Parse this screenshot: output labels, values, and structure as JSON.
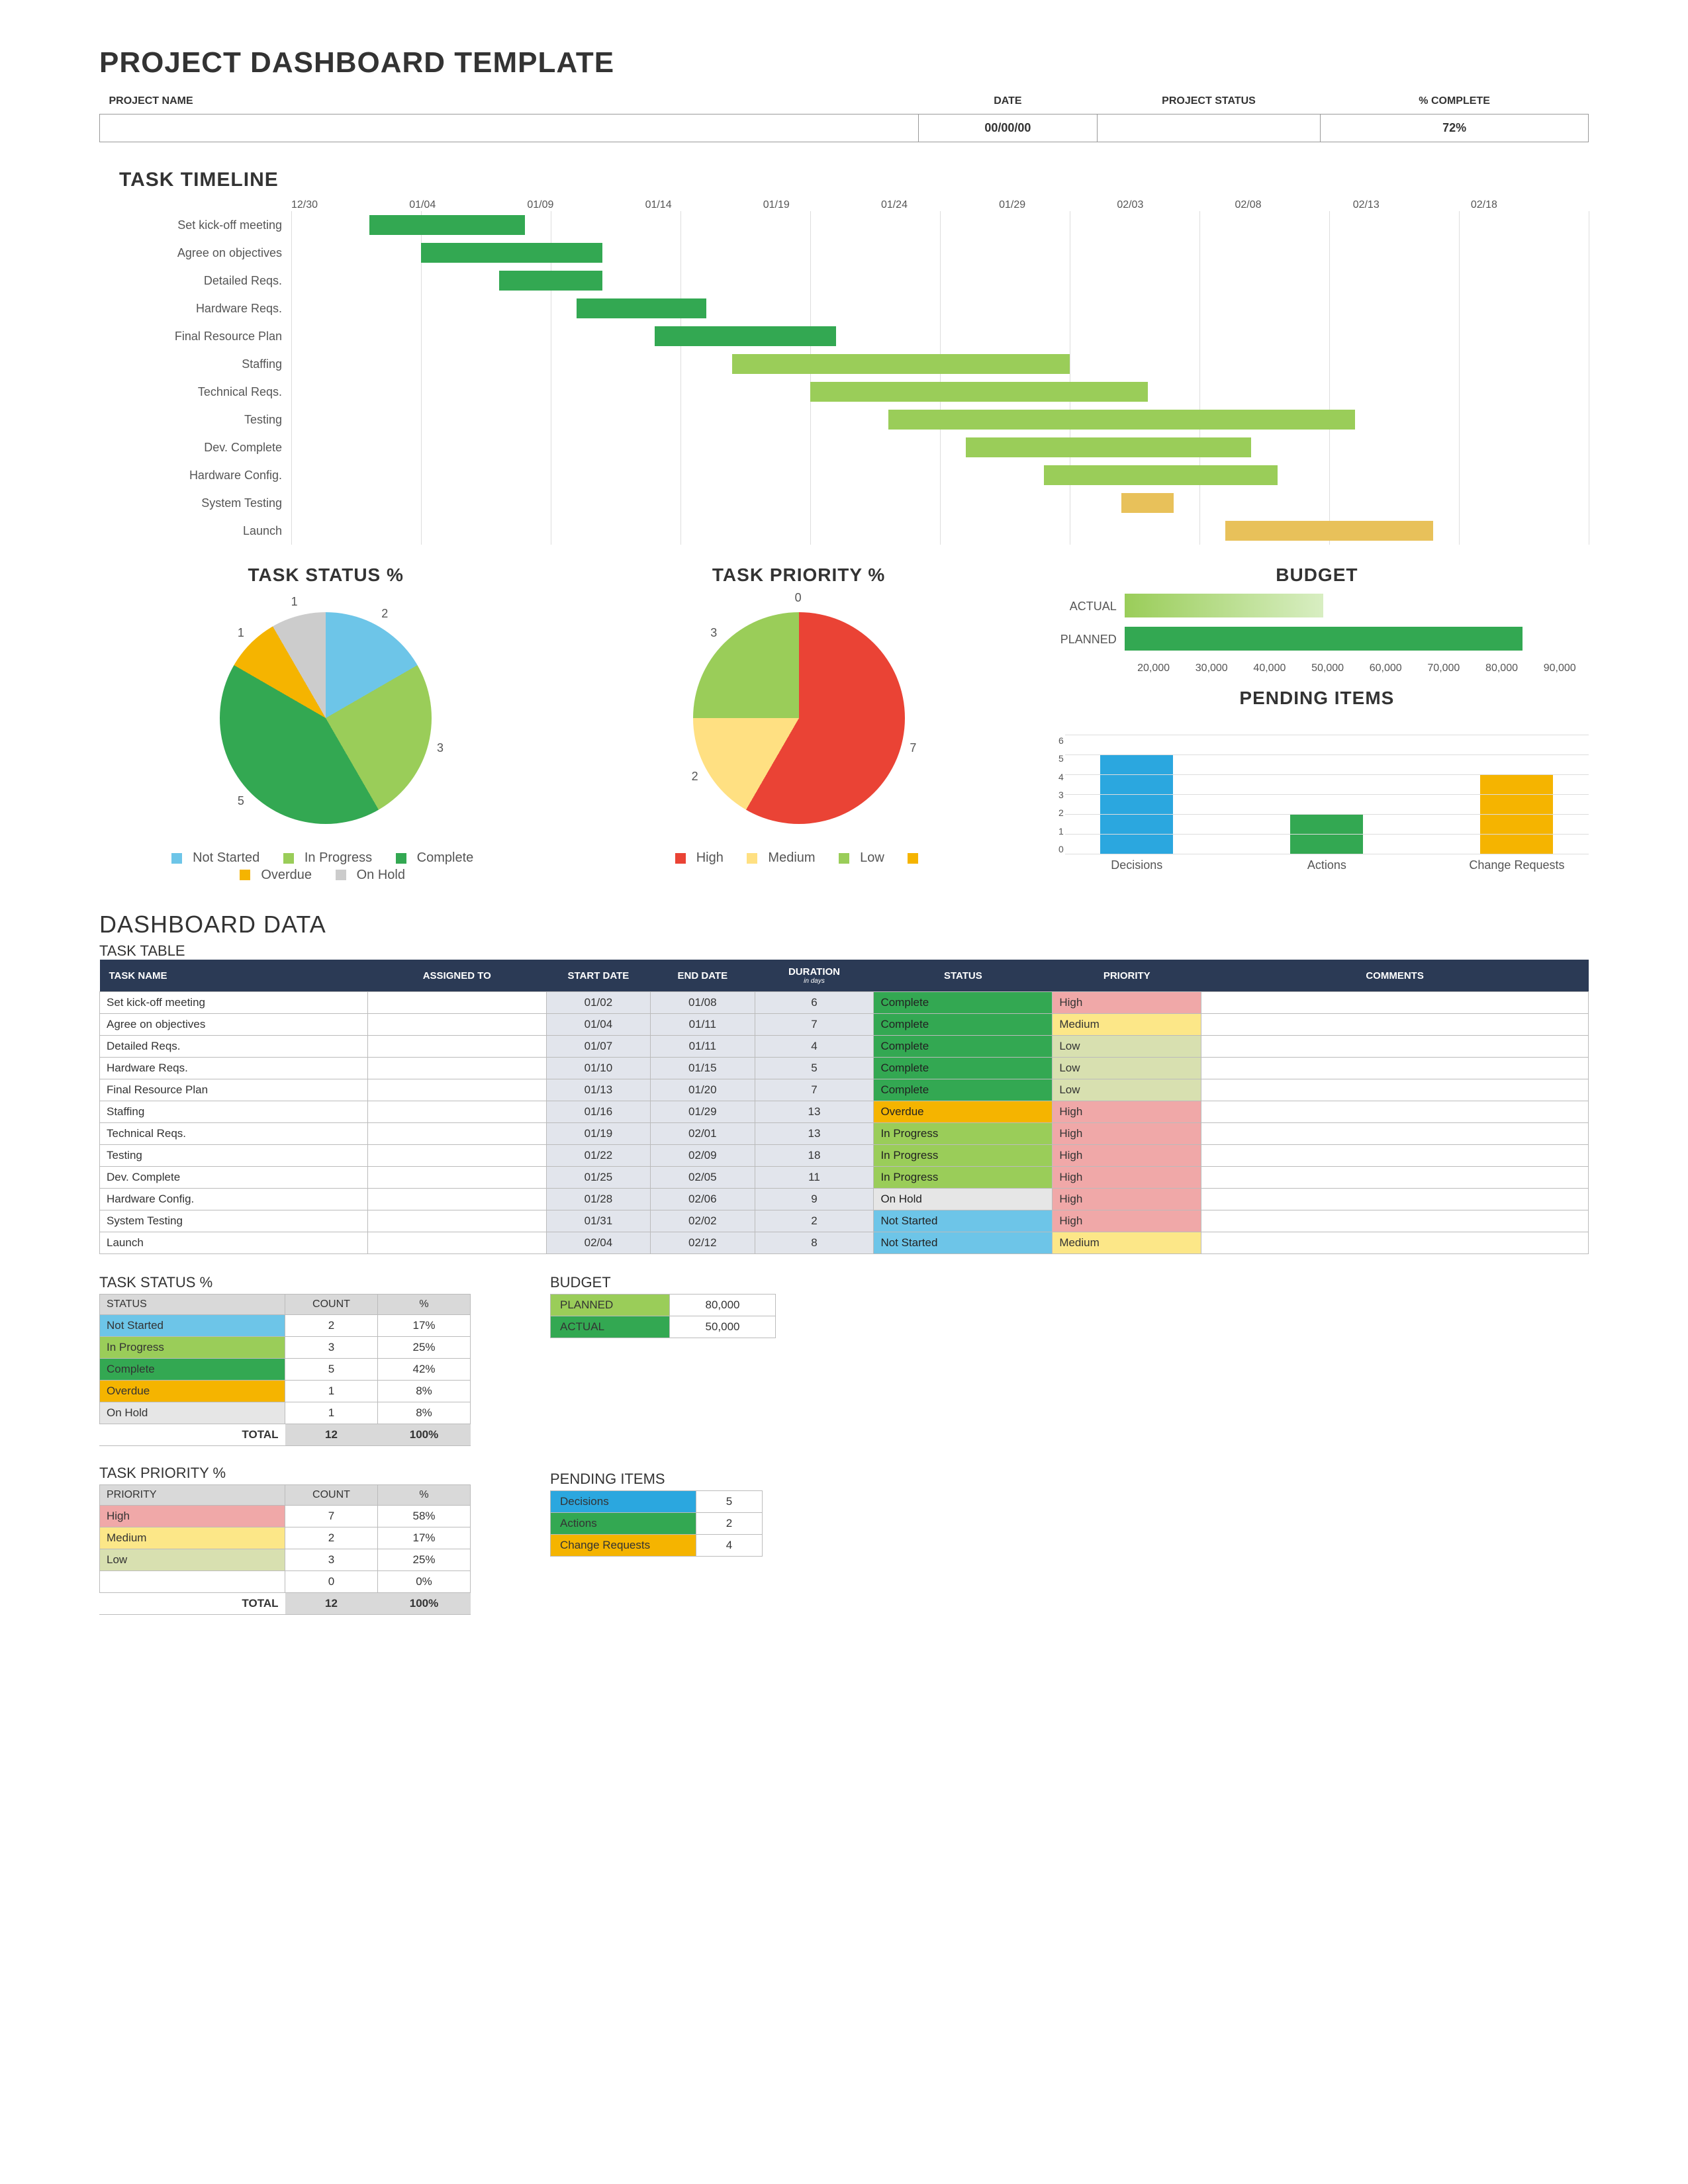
{
  "page": {
    "title": "PROJECT DASHBOARD TEMPLATE"
  },
  "header": {
    "project_name_label": "PROJECT NAME",
    "date_label": "DATE",
    "status_label": "PROJECT STATUS",
    "complete_label": "% COMPLETE",
    "project_name_value": "",
    "date_value": "00/00/00",
    "status_value": "",
    "complete_value": "72%"
  },
  "timeline": {
    "title": "TASK TIMELINE",
    "dates": [
      "12/30",
      "01/04",
      "01/09",
      "01/14",
      "01/19",
      "01/24",
      "01/29",
      "02/03",
      "02/08",
      "02/13",
      "02/18"
    ],
    "tasks": [
      {
        "name": "Set kick-off meeting"
      },
      {
        "name": "Agree on objectives"
      },
      {
        "name": "Detailed Reqs."
      },
      {
        "name": "Hardware Reqs."
      },
      {
        "name": "Final Resource Plan"
      },
      {
        "name": "Staffing"
      },
      {
        "name": "Technical Reqs."
      },
      {
        "name": "Testing"
      },
      {
        "name": "Dev. Complete"
      },
      {
        "name": "Hardware Config."
      },
      {
        "name": "System Testing"
      },
      {
        "name": "Launch"
      }
    ]
  },
  "task_status_chart": {
    "title": "TASK STATUS %"
  },
  "task_priority_chart": {
    "title": "TASK PRIORITY %"
  },
  "budget_chart": {
    "title": "BUDGET",
    "actual_label": "ACTUAL",
    "planned_label": "PLANNED"
  },
  "pending_chart": {
    "title": "PENDING ITEMS"
  },
  "legend_status": {
    "not_started": "Not Started",
    "in_progress": "In Progress",
    "complete": "Complete",
    "overdue": "Overdue",
    "on_hold": "On Hold"
  },
  "legend_priority": {
    "high": "High",
    "medium": "Medium",
    "low": "Low"
  },
  "dashboard": {
    "title": "DASHBOARD DATA",
    "task_table_title": "TASK TABLE",
    "task_status_title": "TASK STATUS %",
    "task_priority_title": "TASK PRIORITY %",
    "budget_title": "BUDGET",
    "pending_title": "PENDING ITEMS"
  },
  "task_table": {
    "headers": {
      "task_name": "TASK NAME",
      "assigned": "ASSIGNED TO",
      "start": "START DATE",
      "end": "END DATE",
      "duration": "DURATION",
      "duration_sub": "in days",
      "status": "STATUS",
      "priority": "PRIORITY",
      "comments": "COMMENTS"
    },
    "rows": [
      {
        "name": "Set kick-off meeting",
        "assigned": "",
        "start": "01/02",
        "end": "01/08",
        "duration": "6",
        "status": "Complete",
        "priority": "High",
        "comments": ""
      },
      {
        "name": "Agree on objectives",
        "assigned": "",
        "start": "01/04",
        "end": "01/11",
        "duration": "7",
        "status": "Complete",
        "priority": "Medium",
        "comments": ""
      },
      {
        "name": "Detailed Reqs.",
        "assigned": "",
        "start": "01/07",
        "end": "01/11",
        "duration": "4",
        "status": "Complete",
        "priority": "Low",
        "comments": ""
      },
      {
        "name": "Hardware Reqs.",
        "assigned": "",
        "start": "01/10",
        "end": "01/15",
        "duration": "5",
        "status": "Complete",
        "priority": "Low",
        "comments": ""
      },
      {
        "name": "Final Resource Plan",
        "assigned": "",
        "start": "01/13",
        "end": "01/20",
        "duration": "7",
        "status": "Complete",
        "priority": "Low",
        "comments": ""
      },
      {
        "name": "Staffing",
        "assigned": "",
        "start": "01/16",
        "end": "01/29",
        "duration": "13",
        "status": "Overdue",
        "priority": "High",
        "comments": ""
      },
      {
        "name": "Technical Reqs.",
        "assigned": "",
        "start": "01/19",
        "end": "02/01",
        "duration": "13",
        "status": "In Progress",
        "priority": "High",
        "comments": ""
      },
      {
        "name": "Testing",
        "assigned": "",
        "start": "01/22",
        "end": "02/09",
        "duration": "18",
        "status": "In Progress",
        "priority": "High",
        "comments": ""
      },
      {
        "name": "Dev. Complete",
        "assigned": "",
        "start": "01/25",
        "end": "02/05",
        "duration": "11",
        "status": "In Progress",
        "priority": "High",
        "comments": ""
      },
      {
        "name": "Hardware Config.",
        "assigned": "",
        "start": "01/28",
        "end": "02/06",
        "duration": "9",
        "status": "On Hold",
        "priority": "High",
        "comments": ""
      },
      {
        "name": "System Testing",
        "assigned": "",
        "start": "01/31",
        "end": "02/02",
        "duration": "2",
        "status": "Not Started",
        "priority": "High",
        "comments": ""
      },
      {
        "name": "Launch",
        "assigned": "",
        "start": "02/04",
        "end": "02/12",
        "duration": "8",
        "status": "Not Started",
        "priority": "Medium",
        "comments": ""
      }
    ]
  },
  "status_summary": {
    "headers": {
      "status": "STATUS",
      "count": "COUNT",
      "pct": "%"
    },
    "rows": [
      {
        "label": "Not Started",
        "count": "2",
        "pct": "17%"
      },
      {
        "label": "In Progress",
        "count": "3",
        "pct": "25%"
      },
      {
        "label": "Complete",
        "count": "5",
        "pct": "42%"
      },
      {
        "label": "Overdue",
        "count": "1",
        "pct": "8%"
      },
      {
        "label": "On Hold",
        "count": "1",
        "pct": "8%"
      }
    ],
    "total_label": "TOTAL",
    "total_count": "12",
    "total_pct": "100%"
  },
  "priority_summary": {
    "headers": {
      "priority": "PRIORITY",
      "count": "COUNT",
      "pct": "%"
    },
    "rows": [
      {
        "label": "High",
        "count": "7",
        "pct": "58%"
      },
      {
        "label": "Medium",
        "count": "2",
        "pct": "17%"
      },
      {
        "label": "Low",
        "count": "3",
        "pct": "25%"
      },
      {
        "label": "",
        "count": "0",
        "pct": "0%"
      }
    ],
    "total_label": "TOTAL",
    "total_count": "12",
    "total_pct": "100%"
  },
  "budget_summary": {
    "planned_label": "PLANNED",
    "planned_value": "80,000",
    "actual_label": "ACTUAL",
    "actual_value": "50,000"
  },
  "pending_summary": {
    "rows": [
      {
        "label": "Decisions",
        "value": "5"
      },
      {
        "label": "Actions",
        "value": "2"
      },
      {
        "label": "Change Requests",
        "value": "4"
      }
    ]
  },
  "chart_data": [
    {
      "type": "gantt",
      "title": "TASK TIMELINE",
      "x_ticks": [
        "12/30",
        "01/04",
        "01/09",
        "01/14",
        "01/19",
        "01/24",
        "01/29",
        "02/03",
        "02/08",
        "02/13",
        "02/18"
      ],
      "x_range_days": 50,
      "tasks": [
        {
          "name": "Set kick-off meeting",
          "start": "01/02",
          "end": "01/08",
          "status": "Complete",
          "color": "#33a852"
        },
        {
          "name": "Agree on objectives",
          "start": "01/04",
          "end": "01/11",
          "status": "Complete",
          "color": "#33a852"
        },
        {
          "name": "Detailed Reqs.",
          "start": "01/07",
          "end": "01/11",
          "status": "Complete",
          "color": "#33a852"
        },
        {
          "name": "Hardware Reqs.",
          "start": "01/10",
          "end": "01/15",
          "status": "Complete",
          "color": "#33a852"
        },
        {
          "name": "Final Resource Plan",
          "start": "01/13",
          "end": "01/20",
          "status": "Complete",
          "color": "#33a852"
        },
        {
          "name": "Staffing",
          "start": "01/16",
          "end": "01/29",
          "status": "Overdue",
          "color": "#9acd59"
        },
        {
          "name": "Technical Reqs.",
          "start": "01/19",
          "end": "02/01",
          "status": "In Progress",
          "color": "#9acd59"
        },
        {
          "name": "Testing",
          "start": "01/22",
          "end": "02/09",
          "status": "In Progress",
          "color": "#9acd59"
        },
        {
          "name": "Dev. Complete",
          "start": "01/25",
          "end": "02/05",
          "status": "In Progress",
          "color": "#9acd59"
        },
        {
          "name": "Hardware Config.",
          "start": "01/28",
          "end": "02/06",
          "status": "On Hold",
          "color": "#9acd59"
        },
        {
          "name": "System Testing",
          "start": "01/31",
          "end": "02/02",
          "status": "Not Started",
          "color": "#e8c15a"
        },
        {
          "name": "Launch",
          "start": "02/04",
          "end": "02/12",
          "status": "Not Started",
          "color": "#e8c15a"
        }
      ]
    },
    {
      "type": "pie",
      "title": "TASK STATUS %",
      "series": [
        {
          "name": "Not Started",
          "value": 2,
          "color": "#6dc5e8"
        },
        {
          "name": "In Progress",
          "value": 3,
          "color": "#9acd59"
        },
        {
          "name": "Complete",
          "value": 5,
          "color": "#33a852"
        },
        {
          "name": "Overdue",
          "value": 1,
          "color": "#f5b400"
        },
        {
          "name": "On Hold",
          "value": 1,
          "color": "#cccccc"
        }
      ],
      "total": 12
    },
    {
      "type": "pie",
      "title": "TASK PRIORITY %",
      "series": [
        {
          "name": "High",
          "value": 7,
          "color": "#ea4335"
        },
        {
          "name": "Medium",
          "value": 2,
          "color": "#ffe082"
        },
        {
          "name": "Low",
          "value": 3,
          "color": "#9acd59"
        },
        {
          "name": "",
          "value": 0,
          "color": "#f5b400"
        }
      ],
      "total": 12
    },
    {
      "type": "bar",
      "orientation": "horizontal",
      "title": "BUDGET",
      "categories": [
        "ACTUAL",
        "PLANNED"
      ],
      "values": [
        50000,
        80000
      ],
      "x_ticks": [
        20000,
        30000,
        40000,
        50000,
        60000,
        70000,
        80000,
        90000
      ],
      "xlim": [
        20000,
        90000
      ],
      "colors": [
        "#9acd59",
        "#33a852"
      ]
    },
    {
      "type": "bar",
      "orientation": "vertical",
      "title": "PENDING ITEMS",
      "categories": [
        "Decisions",
        "Actions",
        "Change Requests"
      ],
      "values": [
        5,
        2,
        4
      ],
      "ylim": [
        0,
        6
      ],
      "y_ticks": [
        0,
        1,
        2,
        3,
        4,
        5,
        6
      ],
      "colors": [
        "#2ba7df",
        "#33a852",
        "#f5b400"
      ]
    }
  ]
}
